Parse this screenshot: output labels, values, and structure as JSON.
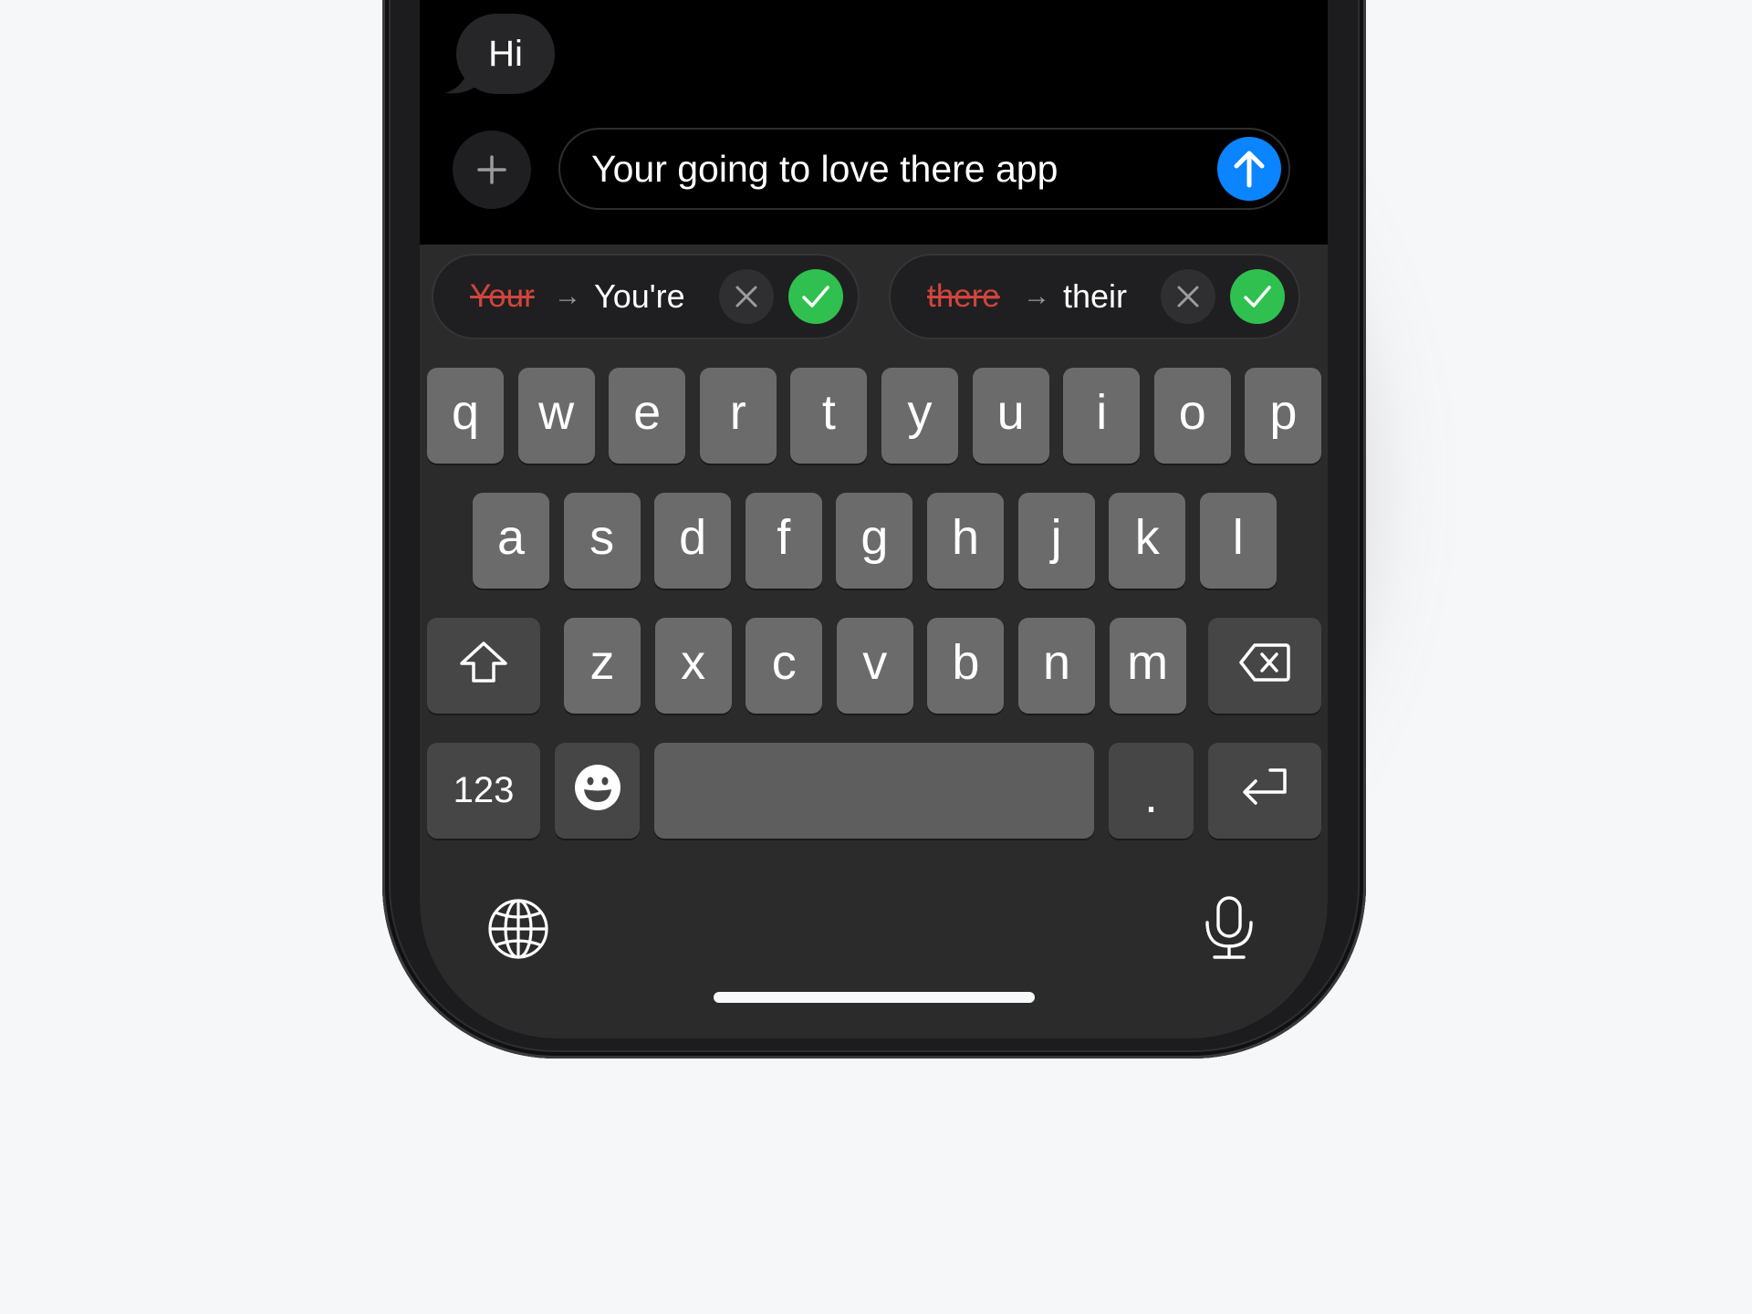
{
  "conversation": {
    "messages": [
      {
        "text": "Hi",
        "direction": "incoming"
      }
    ]
  },
  "composer": {
    "add_icon": "plus-icon",
    "input_value": "Your going to love there app",
    "send_icon": "arrow-up-icon",
    "send_color": "#0a84ff"
  },
  "suggestions": [
    {
      "original": "Your",
      "replacement": "You're",
      "arrow": "→",
      "dismiss_icon": "x-icon",
      "accept_icon": "check-icon"
    },
    {
      "original": "there",
      "replacement": "their",
      "arrow": "→",
      "dismiss_icon": "x-icon",
      "accept_icon": "check-icon"
    }
  ],
  "keyboard": {
    "row1": [
      "q",
      "w",
      "e",
      "r",
      "t",
      "y",
      "u",
      "i",
      "o",
      "p"
    ],
    "row2": [
      "a",
      "s",
      "d",
      "f",
      "g",
      "h",
      "j",
      "k",
      "l"
    ],
    "row3": [
      "z",
      "x",
      "c",
      "v",
      "b",
      "n",
      "m"
    ],
    "shift_icon": "shift-icon",
    "backspace_icon": "backspace-icon",
    "numbers_label": "123",
    "emoji_icon": "emoji-icon",
    "space_label": "",
    "period_label": ".",
    "return_icon": "return-icon",
    "globe_icon": "globe-icon",
    "mic_icon": "microphone-icon"
  },
  "colors": {
    "accept": "#30c04f",
    "strikethrough": "#d0453c",
    "keyboard_bg": "#2b2b2b",
    "key": "#6b6b6b"
  }
}
